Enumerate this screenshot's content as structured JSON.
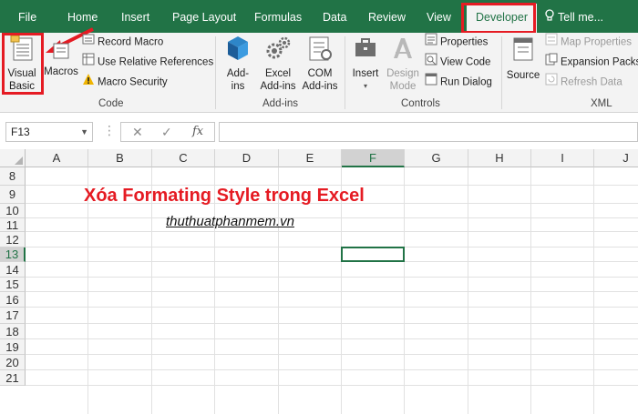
{
  "tabs": {
    "file": "File",
    "home": "Home",
    "insert": "Insert",
    "page_layout": "Page Layout",
    "formulas": "Formulas",
    "data": "Data",
    "review": "Review",
    "view": "View",
    "developer": "Developer",
    "tell_me": "Tell me..."
  },
  "ribbon": {
    "code": {
      "visual_basic_line1": "Visual",
      "visual_basic_line2": "Basic",
      "macros": "Macros",
      "record_macro": "Record Macro",
      "relative_refs": "Use Relative References",
      "macro_security": "Macro Security",
      "group_label": "Code"
    },
    "addins": {
      "addins_line1": "Add-",
      "addins_line2": "ins",
      "excel_addins_line1": "Excel",
      "excel_addins_line2": "Add-ins",
      "com_addins_line1": "COM",
      "com_addins_line2": "Add-ins",
      "group_label": "Add-ins"
    },
    "controls": {
      "insert": "Insert",
      "design_mode_line1": "Design",
      "design_mode_line2": "Mode",
      "properties": "Properties",
      "view_code": "View Code",
      "run_dialog": "Run Dialog",
      "group_label": "Controls"
    },
    "xml": {
      "source": "Source",
      "map_properties": "Map Properties",
      "expansion_packs": "Expansion Packs",
      "refresh_data": "Refresh Data",
      "group_label": "XML"
    }
  },
  "formula_bar": {
    "name_box": "F13",
    "fx": "fx",
    "formula": ""
  },
  "grid": {
    "columns": [
      "A",
      "B",
      "C",
      "D",
      "E",
      "F",
      "G",
      "H",
      "I",
      "J"
    ],
    "selected_column": "F",
    "rows": [
      "8",
      "9",
      "10",
      "11",
      "12",
      "13",
      "14",
      "15",
      "16",
      "17",
      "18",
      "19",
      "20",
      "21"
    ],
    "selected_row": "13",
    "title": "Xóa Formating Style trong Excel",
    "subtitle": "thuthuatphanmem.vn"
  },
  "colors": {
    "accent": "#217346",
    "highlight": "#e51b23"
  }
}
